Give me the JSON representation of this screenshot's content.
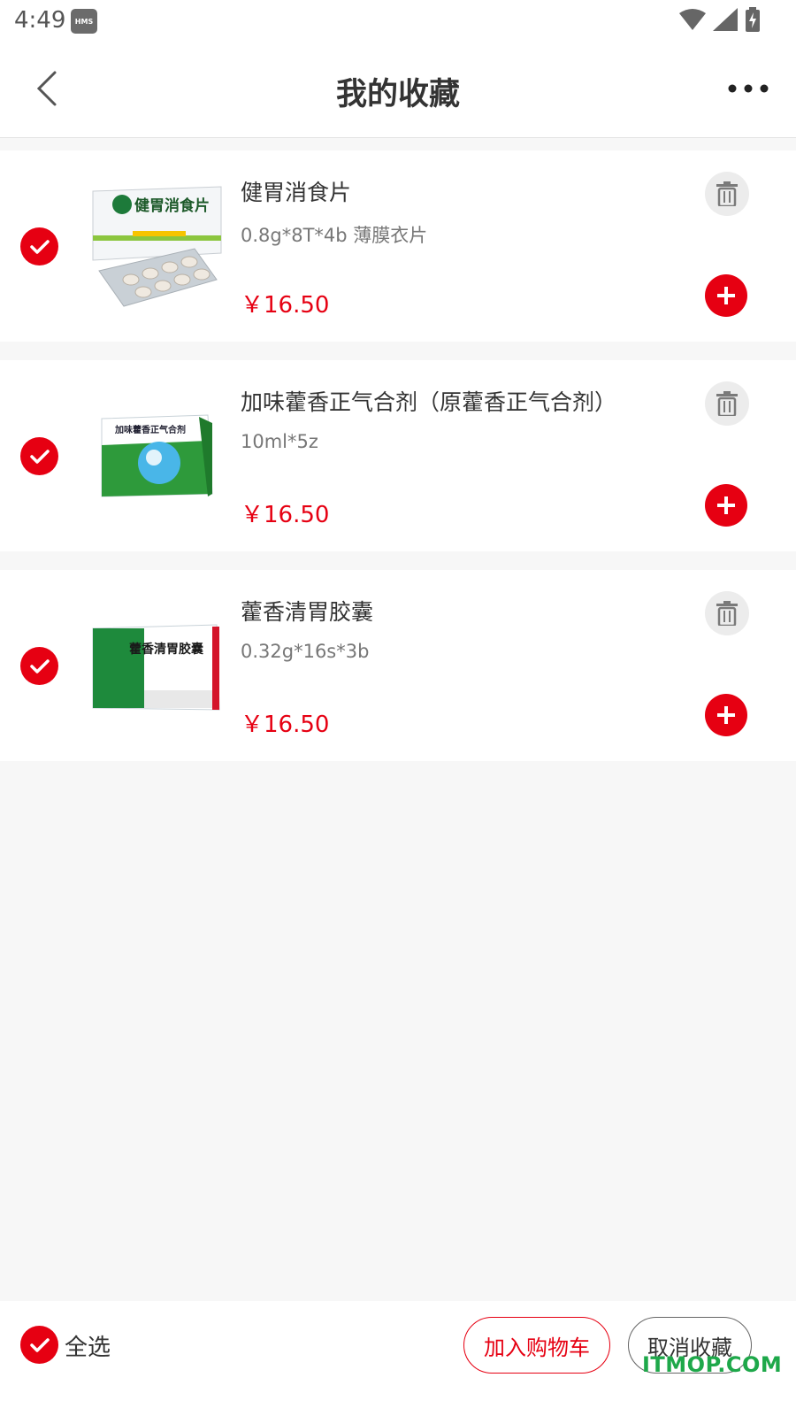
{
  "status_bar": {
    "time": "4:49",
    "hms_badge": "HMS"
  },
  "header": {
    "title": "我的收藏"
  },
  "items": [
    {
      "name": "健胃消食片",
      "spec": "0.8g*8T*4b  薄膜衣片",
      "price": "￥16.50",
      "checked": true,
      "box_label": "健胃消食片"
    },
    {
      "name": "加味藿香正气合剂（原藿香正气合剂）",
      "spec": "10ml*5z",
      "price": "￥16.50",
      "checked": true,
      "box_label": "加味藿香正气合剂"
    },
    {
      "name": "藿香清胃胶囊",
      "spec": "0.32g*16s*3b",
      "price": "￥16.50",
      "checked": true,
      "box_label": "藿香清胃胶囊"
    }
  ],
  "bottom_bar": {
    "select_all_label": "全选",
    "add_to_cart_label": "加入购物车",
    "unfavorite_label": "取消收藏"
  },
  "watermark": "ITMOP.COM",
  "colors": {
    "accent": "#e60012",
    "background": "#f7f7f7"
  }
}
